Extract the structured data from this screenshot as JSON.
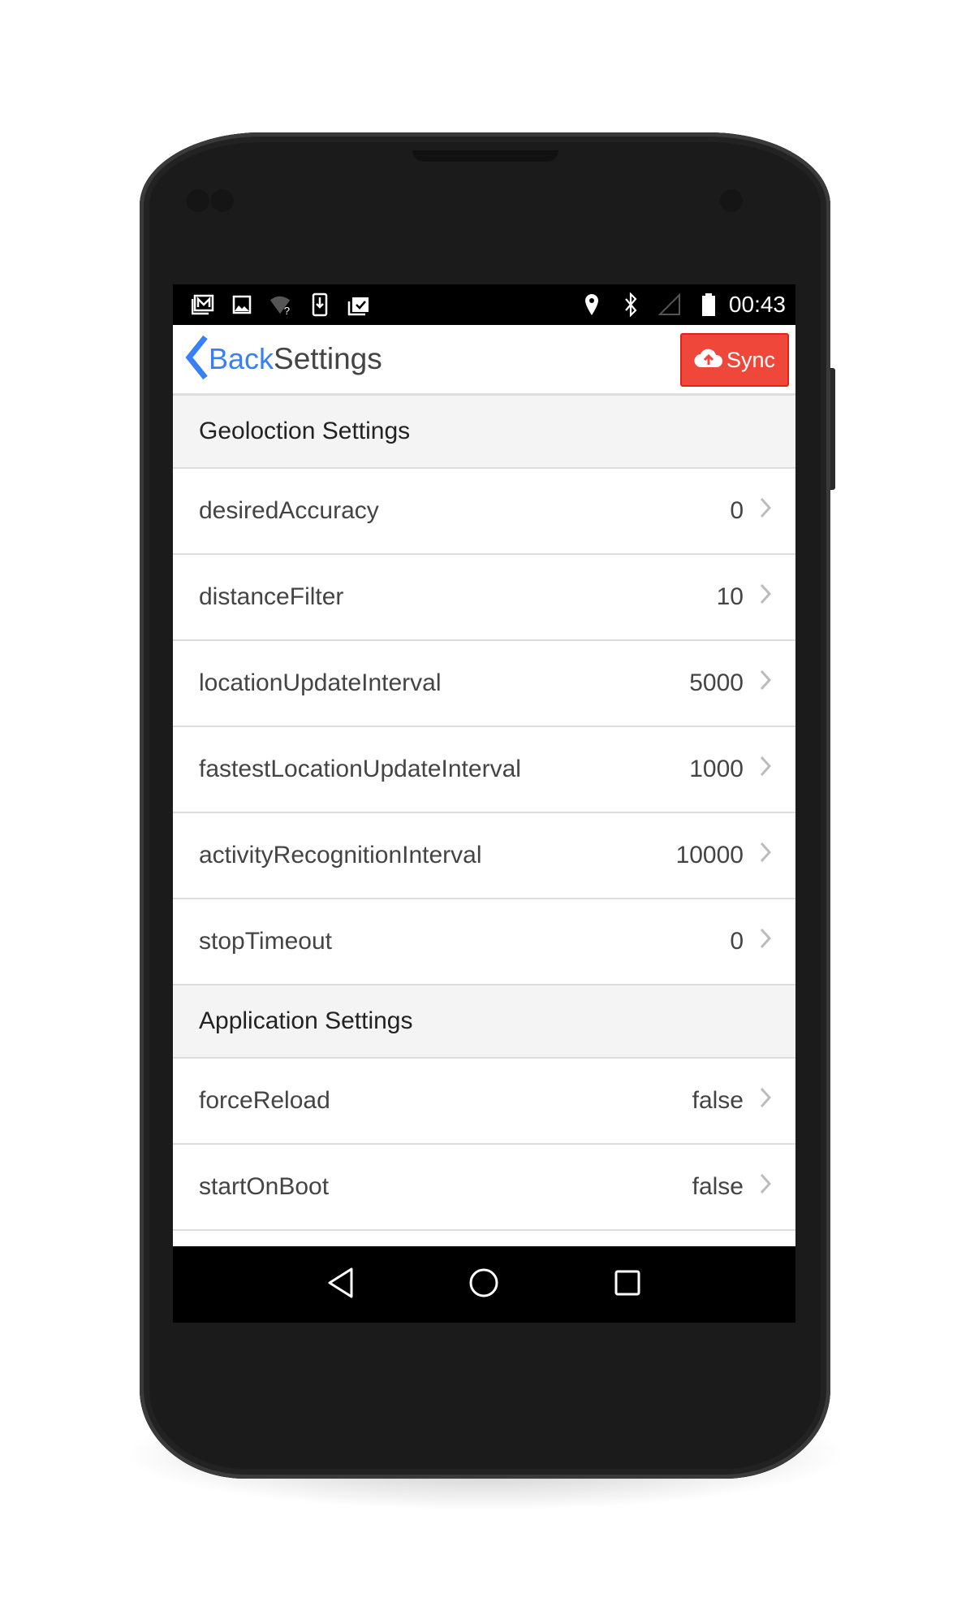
{
  "status_bar": {
    "left_icons": [
      "gmail-icon",
      "image-icon",
      "wifi-unknown-icon",
      "download-icon",
      "clipboard-check-icon"
    ],
    "right_icons": [
      "location-icon",
      "bluetooth-icon",
      "signal-icon",
      "battery-icon"
    ],
    "time": "00:43"
  },
  "header": {
    "back_label": "Back",
    "title": "Settings",
    "sync_label": "Sync",
    "accent": "#3880f5",
    "sync_color": "#ef473a"
  },
  "sections": [
    {
      "title": "Geoloction Settings",
      "items": [
        {
          "label": "desiredAccuracy",
          "value": "0"
        },
        {
          "label": "distanceFilter",
          "value": "10"
        },
        {
          "label": "locationUpdateInterval",
          "value": "5000"
        },
        {
          "label": "fastestLocationUpdateInterval",
          "value": "1000"
        },
        {
          "label": "activityRecognitionInterval",
          "value": "10000"
        },
        {
          "label": "stopTimeout",
          "value": "0"
        }
      ]
    },
    {
      "title": "Application Settings",
      "items": [
        {
          "label": "forceReload",
          "value": "false"
        },
        {
          "label": "startOnBoot",
          "value": "false"
        }
      ]
    }
  ]
}
